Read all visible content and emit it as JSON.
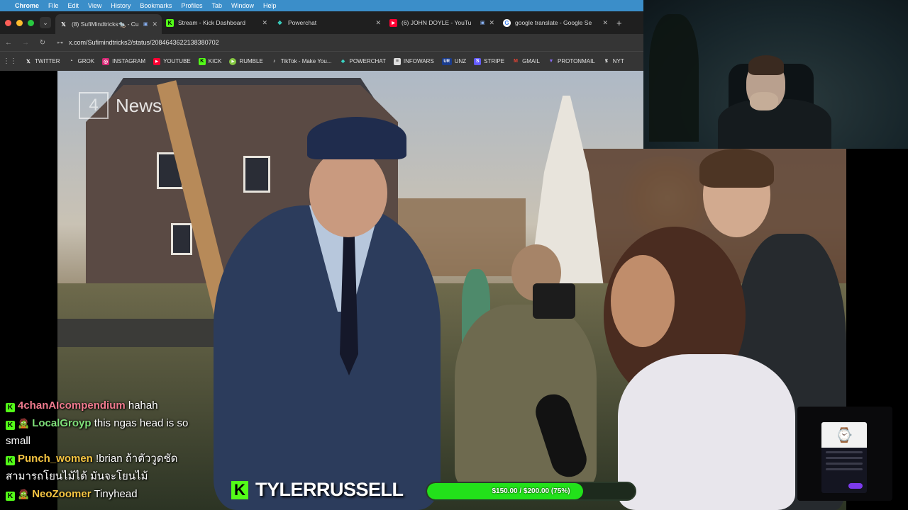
{
  "menubar": {
    "app": "Chrome",
    "items": [
      "File",
      "Edit",
      "View",
      "History",
      "Bookmarks",
      "Profiles",
      "Tab",
      "Window",
      "Help"
    ]
  },
  "tabs": [
    {
      "title": "(8) SufiMindtricks🐀 - Cu",
      "favicon": "x-icon",
      "active": true
    },
    {
      "title": "Stream - Kick Dashboard",
      "favicon": "kick-icon",
      "active": false
    },
    {
      "title": "Powerchat",
      "favicon": "powerchat-icon",
      "active": false
    },
    {
      "title": "(6) JOHN DOYLE - YouTu",
      "favicon": "youtube-icon",
      "active": false
    },
    {
      "title": "google translate - Google Se",
      "favicon": "google-icon",
      "active": false
    }
  ],
  "address": {
    "url": "x.com/Sufimindtricks2/status/2084643622138380702"
  },
  "bookmarks": [
    {
      "label": "TWITTER",
      "icon": "x-icon"
    },
    {
      "label": "GROK",
      "icon": "grok-icon"
    },
    {
      "label": "INSTAGRAM",
      "icon": "instagram-icon"
    },
    {
      "label": "YOUTUBE",
      "icon": "youtube-icon"
    },
    {
      "label": "KICK",
      "icon": "kick-icon"
    },
    {
      "label": "RUMBLE",
      "icon": "rumble-icon"
    },
    {
      "label": "TikTok - Make You...",
      "icon": "tiktok-icon"
    },
    {
      "label": "POWERCHAT",
      "icon": "powerchat-icon"
    },
    {
      "label": "INFOWARS",
      "icon": "infowars-icon"
    },
    {
      "label": "UNZ",
      "icon": "unz-icon"
    },
    {
      "label": "STRIPE",
      "icon": "stripe-icon"
    },
    {
      "label": "GMAIL",
      "icon": "gmail-icon"
    },
    {
      "label": "PROTONMAIL",
      "icon": "protonmail-icon"
    },
    {
      "label": "NYT",
      "icon": "nyt-icon"
    }
  ],
  "video": {
    "logo_text": "News",
    "logo_number": "4"
  },
  "chat": [
    {
      "user": "4chanAIcompendium",
      "user_color": "#f07b8e",
      "message": "hahah",
      "badge": "kick"
    },
    {
      "user": "LocalGroyp",
      "user_color": "#7fe07a",
      "message": "this ngas head is so small",
      "badge": "kick",
      "emoji": "🧟"
    },
    {
      "user": "Punch_women",
      "user_color": "#f5c542",
      "message": "!brian ถ้าตัววูดชัดสามารถโยนไม้ได้ มันจะโยนไม้",
      "badge": "kick"
    },
    {
      "user": "NeoZoomer",
      "user_color": "#f5c542",
      "message": "Tinyhead",
      "badge": "kick",
      "emoji": "🧟"
    }
  ],
  "streamer": {
    "name": "TYLERRUSSELL"
  },
  "goal": {
    "text": "$150.00 / $200.00 (75%)",
    "fraction": 0.75
  }
}
